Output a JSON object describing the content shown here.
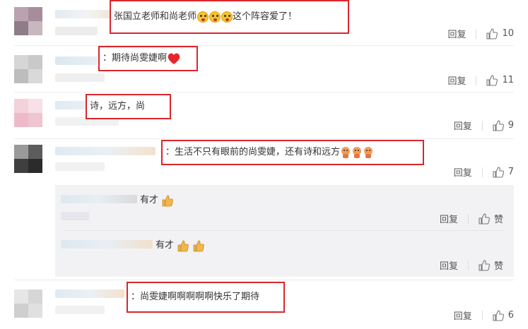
{
  "comments": [
    {
      "text": "张国立老师和尚老师",
      "text_suffix": "这个阵容爱了！",
      "reply_label": "回复",
      "likes": "10"
    },
    {
      "text": "：期待尚雯婕啊",
      "reply_label": "回复",
      "likes": "11"
    },
    {
      "text": "诗，远方，尚",
      "reply_label": "回复",
      "likes": "9"
    },
    {
      "text": "：生活不只有眼前的尚雯婕，还有诗和远方",
      "reply_label": "回复",
      "likes": "7"
    },
    {
      "text": "：尚雯婕啊啊啊啊啊快乐了期待",
      "reply_label": "回复",
      "likes": "6"
    }
  ],
  "replies": [
    {
      "text": "有才",
      "reply_label": "回复",
      "like_label": "赞"
    },
    {
      "text": "有才",
      "reply_label": "回复",
      "like_label": "赞"
    }
  ],
  "icons": {
    "like": "thumbs-up-outline-icon",
    "emoji_shock": "shocked-face-emoji",
    "emoji_heart": "red-heart-emoji",
    "emoji_thumb": "thumbs-up-emoji",
    "emoji_doge": "fist-emoji"
  },
  "colors": {
    "highlight_border": "#d9262c",
    "reply_bg": "#f2f2f5"
  }
}
